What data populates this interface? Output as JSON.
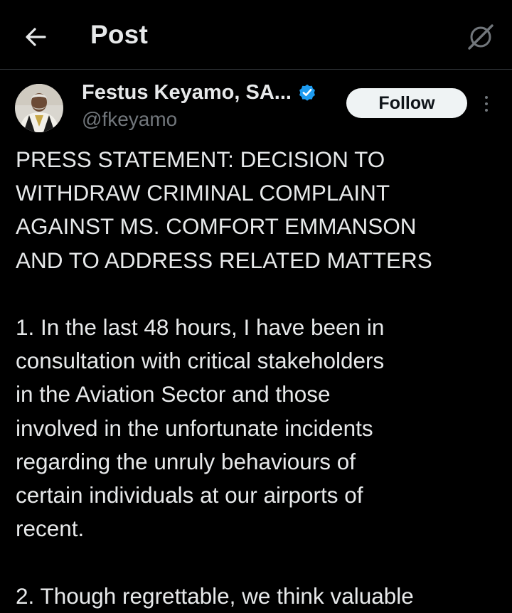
{
  "header": {
    "title": "Post"
  },
  "author": {
    "display_name": "Festus Keyamo, SA...",
    "handle": "@fkeyamo",
    "follow_label": "Follow"
  },
  "post": {
    "lines": [
      "PRESS STATEMENT: DECISION TO",
      "WITHDRAW CRIMINAL COMPLAINT",
      "AGAINST MS. COMFORT EMMANSON",
      "AND TO ADDRESS RELATED MATTERS",
      "",
      "1. In the last 48 hours, I have been in",
      "consultation with critical stakeholders",
      "in the Aviation Sector and those",
      "involved in the unfortunate incidents",
      "regarding the unruly behaviours of",
      "certain individuals at our airports of",
      "recent.",
      "",
      "2. Though regrettable, we think valuable"
    ]
  },
  "colors": {
    "background": "#000000",
    "text": "#e7e9ea",
    "secondary_text": "#71767b",
    "verified_badge": "#1d9bf0",
    "follow_button_bg": "#eff3f4"
  },
  "icons": {
    "back": "arrow-left-icon",
    "grok": "grok-icon",
    "verified": "verified-badge-icon",
    "more": "more-vertical-icon"
  }
}
